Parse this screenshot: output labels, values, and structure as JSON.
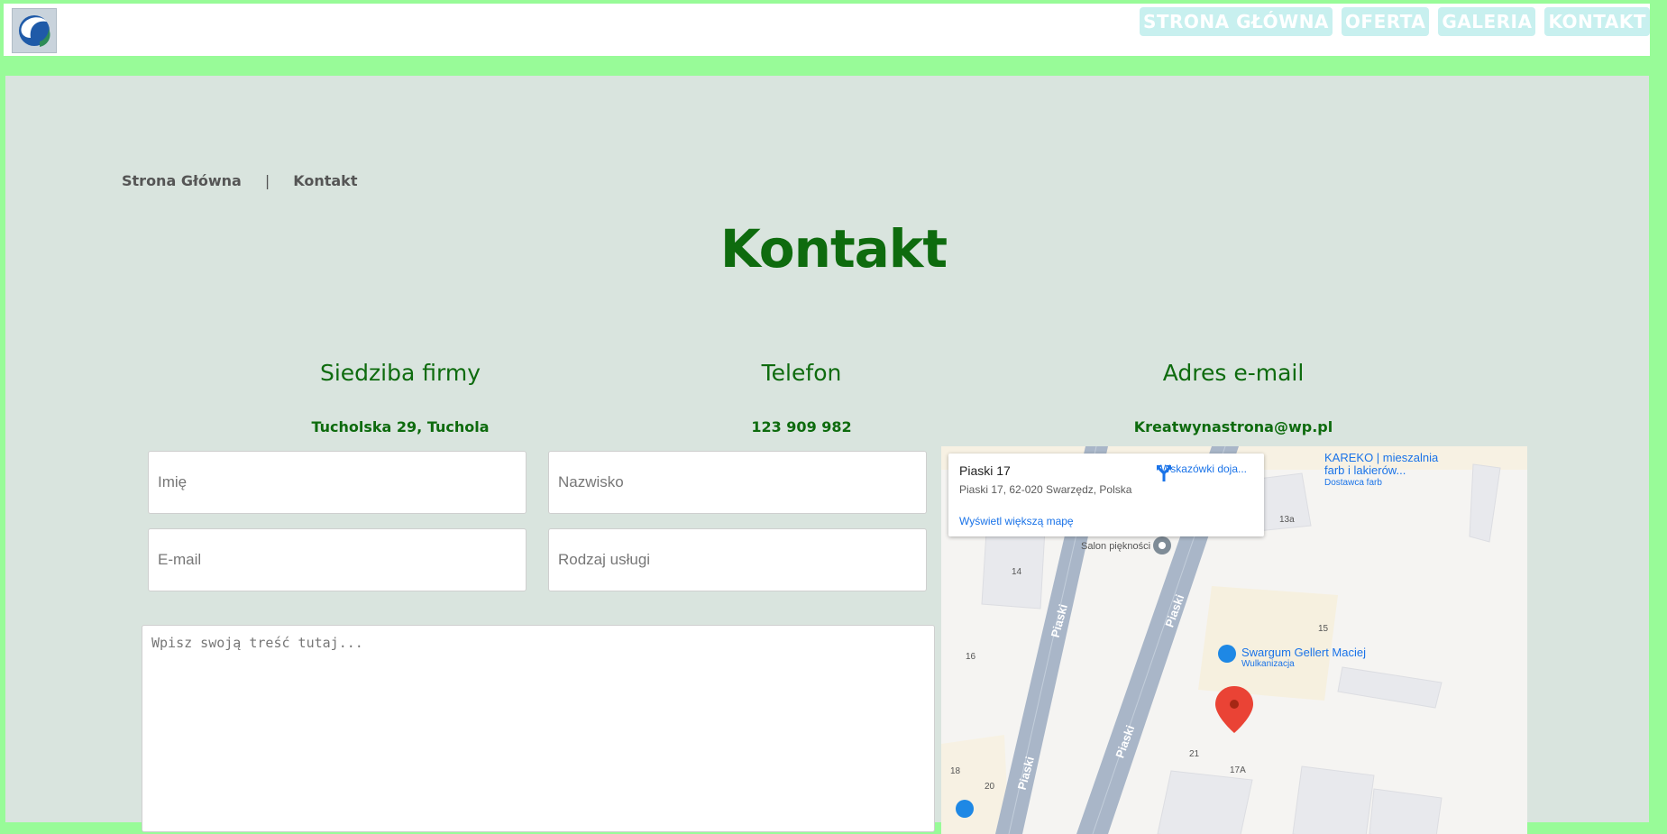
{
  "header": {
    "logo_alt": "logo",
    "nav": [
      "STRONA GŁÓWNA",
      "OFERTA",
      "GALERIA",
      "KONTAKT"
    ]
  },
  "breadcrumb": {
    "home": "Strona Główna",
    "separator": "|",
    "current": "Kontakt"
  },
  "page_title": "Kontakt",
  "info": {
    "address": {
      "heading": "Siedziba firmy",
      "value": "Tucholska 29, Tuchola"
    },
    "phone": {
      "heading": "Telefon",
      "value": "123 909 982"
    },
    "email": {
      "heading": "Adres e-mail",
      "value": "Kreatwynastrona@wp.pl"
    }
  },
  "form": {
    "first_name_placeholder": "Imię",
    "last_name_placeholder": "Nazwisko",
    "email_placeholder": "E-mail",
    "service_placeholder": "Rodzaj usługi",
    "message_placeholder": "Wpisz swoją treść tutaj..."
  },
  "map": {
    "card_title": "Piaski 17",
    "card_address": "Piaski 17, 62-020 Swarzędz, Polska",
    "directions_label": "Wskazówki doja...",
    "larger_map_label": "Wyświetl większą mapę",
    "place1_name": "KAREKO | mieszalnia",
    "place1_name2": "farb i lakierów...",
    "place1_type": "Dostawca farb",
    "place2_name": "Salon piękności",
    "place3_name": "Swargum Gellert Maciej",
    "place3_type": "Wulkanizacja",
    "street_label": "Piaski",
    "numbers": [
      "13a",
      "14",
      "15",
      "16",
      "18",
      "20",
      "21",
      "17A"
    ]
  },
  "colors": {
    "frame": "#98fb98",
    "content_bg": "#d9e4de",
    "heading_green": "#0e6b0e",
    "nav_bg": "#c8f0ef"
  }
}
